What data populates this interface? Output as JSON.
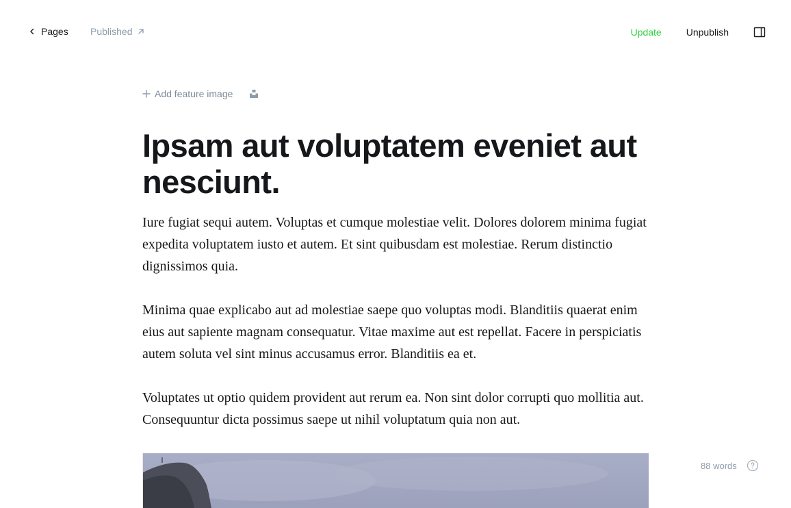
{
  "header": {
    "back_label": "Pages",
    "status_label": "Published",
    "update_label": "Update",
    "unpublish_label": "Unpublish",
    "accent_color": "#30cf43"
  },
  "editor": {
    "add_feature_image_label": "Add feature image",
    "unsplash_icon": "unsplash-icon",
    "title": "Ipsam aut voluptatem eveniet aut nesciunt.",
    "paragraphs": [
      "Iure fugiat sequi autem. Voluptas et cumque molestiae velit. Dolores dolorem minima fugiat expedita voluptatem iusto et autem. Et sint quibusdam est molestiae. Rerum distinctio dignissimos quia.",
      "Minima quae explicabo aut ad molestiae saepe quo voluptas modi. Blanditiis quaerat enim eius aut sapiente magnam consequatur. Vitae maxime aut est repellat. Facere in perspiciatis autem soluta vel sint minus accusamus error. Blanditiis ea et.",
      "Voluptates ut optio quidem provident aut rerum ea. Non sint dolor corrupti quo mollitia aut. Consequuntur dicta possimus saepe ut nihil voluptatum quia non aut."
    ]
  },
  "footer": {
    "word_count": "88 words",
    "help_icon": "question-circle-icon"
  }
}
